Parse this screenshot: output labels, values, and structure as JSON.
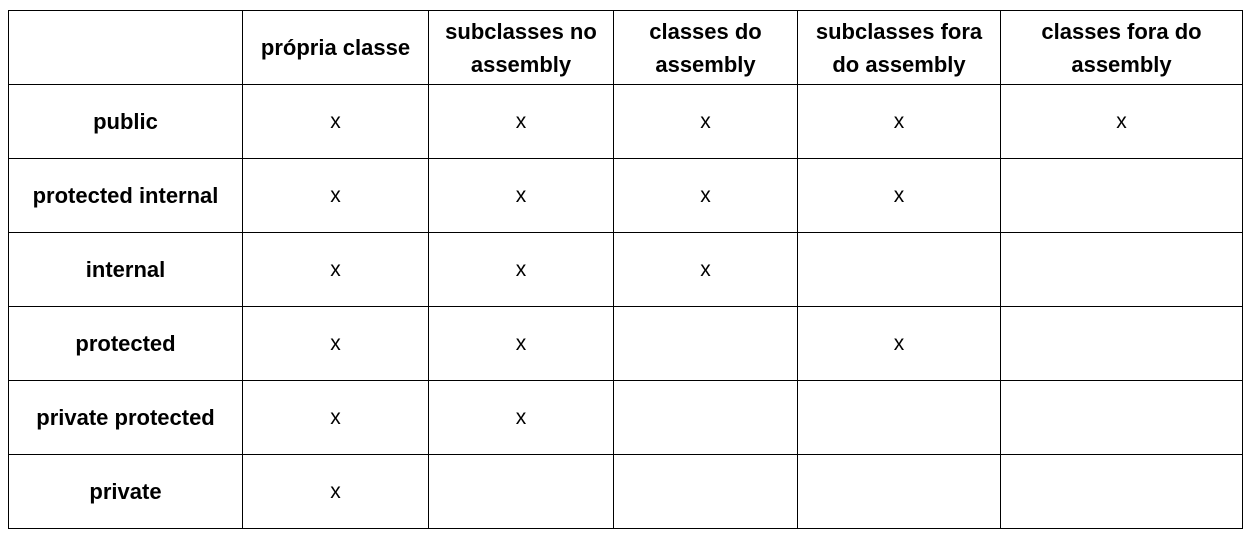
{
  "table": {
    "columns": [
      "",
      "própria classe",
      "subclasses no assembly",
      "classes do assembly",
      "subclasses fora do assembly",
      "classes fora do assembly"
    ],
    "rows": [
      {
        "label": "public",
        "cells": [
          "x",
          "x",
          "x",
          "x",
          "x"
        ]
      },
      {
        "label": "protected internal",
        "cells": [
          "x",
          "x",
          "x",
          "x",
          ""
        ]
      },
      {
        "label": "internal",
        "cells": [
          "x",
          "x",
          "x",
          "",
          ""
        ]
      },
      {
        "label": "protected",
        "cells": [
          "x",
          "x",
          "",
          "x",
          ""
        ]
      },
      {
        "label": "private protected",
        "cells": [
          "x",
          "x",
          "",
          "",
          ""
        ]
      },
      {
        "label": "private",
        "cells": [
          "x",
          "",
          "",
          "",
          ""
        ]
      }
    ]
  }
}
